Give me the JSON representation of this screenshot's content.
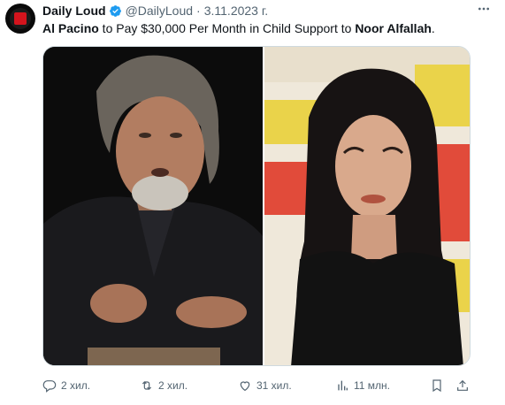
{
  "tweet": {
    "author": {
      "display_name": "Daily Loud",
      "handle": "@DailyLoud",
      "verified": true
    },
    "separator": "·",
    "date": "3.11.2023 г.",
    "text": {
      "part1": "Al Pacino",
      "part2": " to Pay $30,000 Per Month in Child Support to ",
      "part3": "Noor Alfallah",
      "part4": "."
    },
    "actions": {
      "replies": "2 хил.",
      "reposts": "2 хил.",
      "likes": "31 хил.",
      "views": "11 млн."
    }
  },
  "colors": {
    "text": "#0f1419",
    "secondary": "#536471",
    "verified": "#1d9bf0",
    "border": "#cfd9de"
  },
  "icons": [
    "more-icon",
    "verified-icon",
    "reply-icon",
    "repost-icon",
    "like-icon",
    "views-icon",
    "bookmark-icon",
    "share-icon"
  ]
}
